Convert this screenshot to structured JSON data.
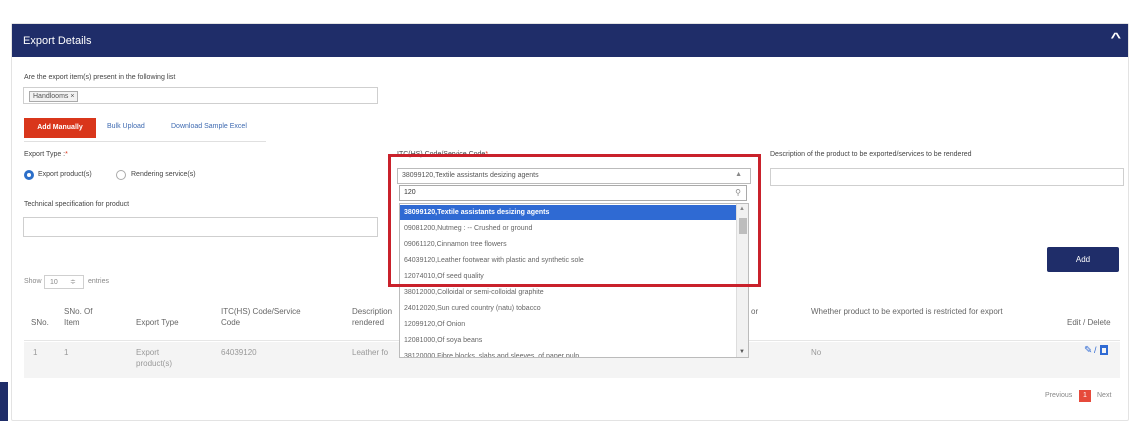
{
  "panel": {
    "title": "Export Details",
    "collapse_icon": "chevron-up-icon"
  },
  "question": {
    "label": "Are the export item(s) present in the following list",
    "chip": "Handlooms",
    "chip_remove": "×"
  },
  "tabs": {
    "add_manually": "Add Manually",
    "bulk_upload": "Bulk Upload",
    "download_sample": "Download Sample Excel"
  },
  "export_type": {
    "label": "Export Type :",
    "required_mark": "*",
    "option1": "Export product(s)",
    "option2": "Rendering service(s)",
    "selected": "Export product(s)"
  },
  "itc": {
    "label": "ITC(HS) Code/Service Code",
    "required_mark": "*",
    "selected_value": "38099120,Textile assistants desizing agents",
    "search_value": "120",
    "options": [
      "38099120,Textile assistants desizing agents",
      "09081200,Nutmeg : -- Crushed or ground",
      "09061120,Cinnamon tree flowers",
      "64039120,Leather footwear with plastic and synthetic sole",
      "12074010,Of seed quality",
      "38012000,Colloidal or semi-colloidal graphite",
      "24012020,Sun cured country (natu) tobacco",
      "12099120,Of Onion",
      "12081000,Of soya beans",
      "38120000,Fibre blocks, slabs and sleeves, of paper pulp"
    ],
    "highlighted_index": 0
  },
  "description": {
    "label": "Description of the product to be exported/services to be rendered"
  },
  "tech_spec": {
    "label": "Technical specification for product"
  },
  "add_button": "Add",
  "table": {
    "show_label": "Show",
    "entries_value": "10",
    "entries_label": "entries",
    "headers": {
      "sno": "SNo.",
      "sno_item": "SNo. Of Item",
      "export_type": "Export Type",
      "itc": "ITC(HS) Code/Service Code",
      "desc": "Description rendered",
      "desc_tail": "or",
      "restricted": "Whether product to be exported is restricted for export",
      "edit_delete": "Edit / Delete"
    },
    "rows": [
      {
        "sno": "1",
        "sno_item": "1",
        "export_type": "Export product(s)",
        "itc": "64039120",
        "desc": "Leather fo",
        "restricted": "No"
      }
    ]
  },
  "pagination": {
    "previous": "Previous",
    "current": "1",
    "next": "Next"
  },
  "colors": {
    "header": "#1f2d69",
    "accent_red": "#d9361b",
    "highlight_frame": "#c9212b",
    "selected_option": "#2f6ad3"
  }
}
